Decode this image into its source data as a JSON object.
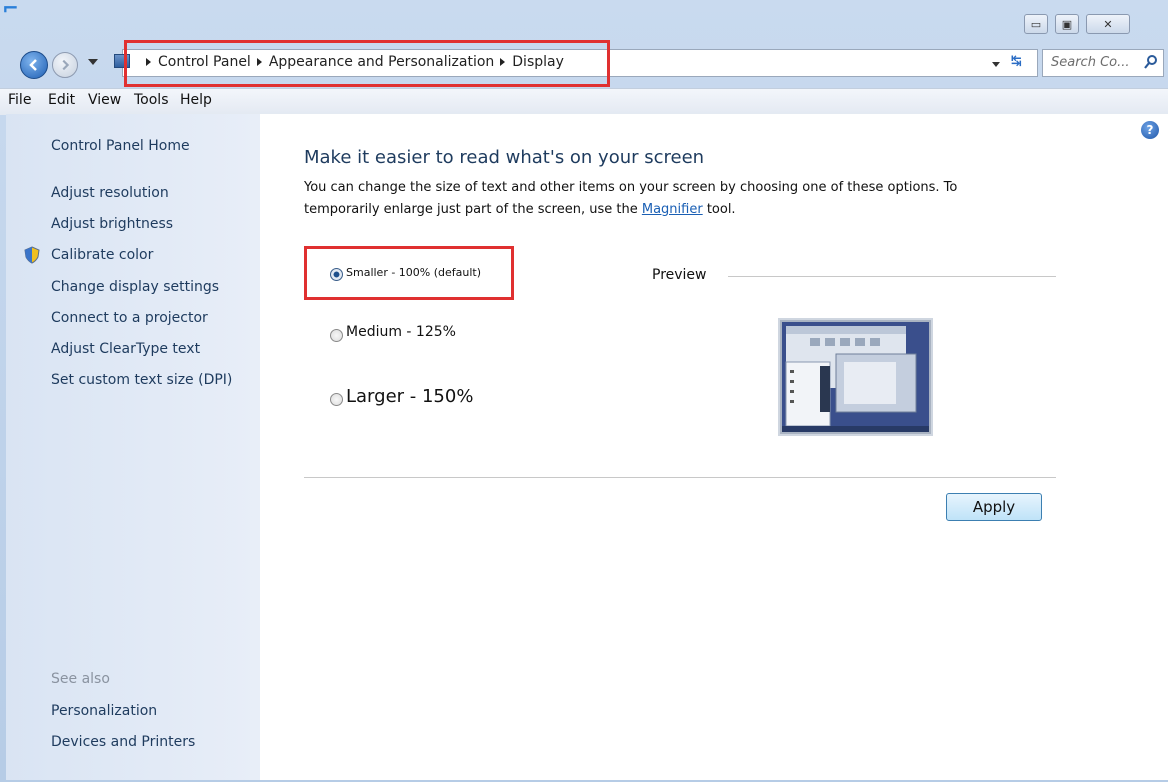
{
  "breadcrumb": [
    "Control Panel",
    "Appearance and Personalization",
    "Display"
  ],
  "search": {
    "placeholder": "Search Co..."
  },
  "menu": [
    "File",
    "Edit",
    "View",
    "Tools",
    "Help"
  ],
  "sidebar": {
    "home": "Control Panel Home",
    "links": [
      "Adjust resolution",
      "Adjust brightness",
      "Calibrate color",
      "Change display settings",
      "Connect to a projector",
      "Adjust ClearType text",
      "Set custom text size (DPI)"
    ],
    "see_also_title": "See also",
    "see_also": [
      "Personalization",
      "Devices and Printers"
    ]
  },
  "main": {
    "title": "Make it easier to read what's on your screen",
    "desc_line1": "You can change the size of text and other items on your screen by choosing one of these options. To",
    "desc_pre": "temporarily enlarge just part of the screen, use the ",
    "desc_link": "Magnifier",
    "desc_post": " tool.",
    "options": [
      {
        "label": "Smaller - 100% (default)",
        "selected": true
      },
      {
        "label": "Medium - 125%",
        "selected": false
      },
      {
        "label": "Larger - 150%",
        "selected": false
      }
    ],
    "preview_label": "Preview",
    "apply_label": "Apply"
  },
  "colors": {
    "highlight": "#e03030",
    "link": "#1a5fb4",
    "title": "#1e3b5e"
  },
  "icons": [
    "back-icon",
    "forward-icon",
    "dropdown-icon",
    "control-panel-icon",
    "refresh-icon",
    "search-icon",
    "help-icon",
    "shield-icon",
    "minimize-icon",
    "maximize-icon",
    "close-icon"
  ]
}
